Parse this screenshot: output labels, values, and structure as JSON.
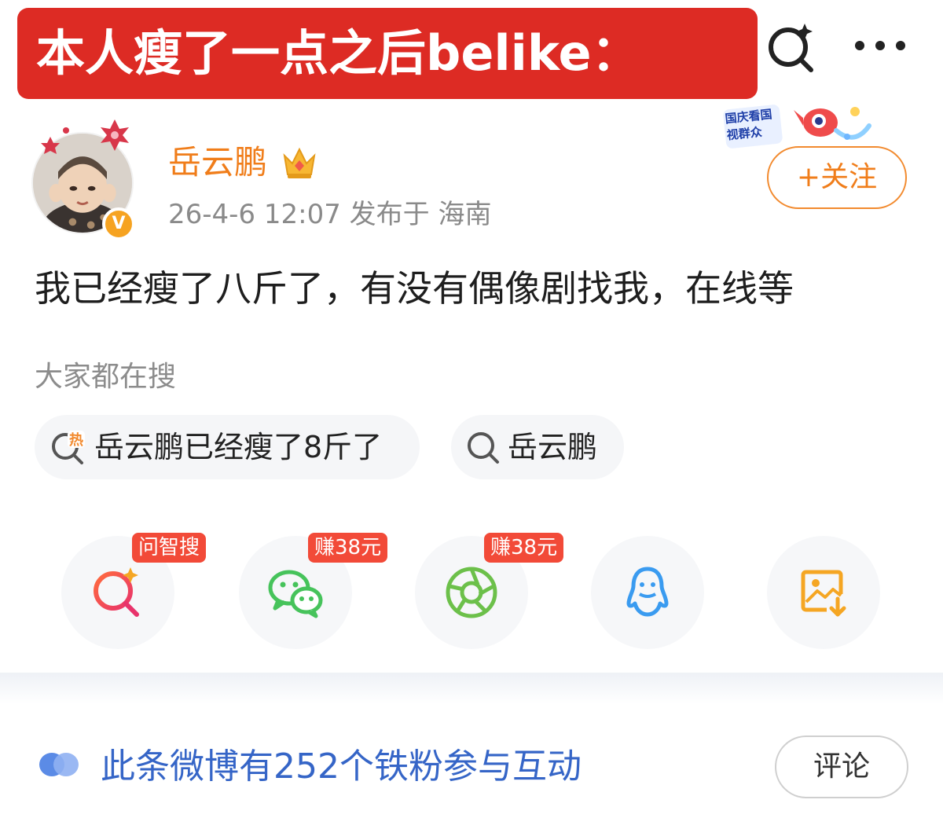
{
  "banner": {
    "title": "本人瘦了一点之后belike："
  },
  "event_badge": {
    "text": "国庆看国视群众"
  },
  "author": {
    "name": "岳云鹏",
    "verified_mark": "V",
    "meta": "26-4-6 12:07  发布于 海南",
    "follow_label": "+关注"
  },
  "post": {
    "text": "我已经瘦了八斤了，有没有偶像剧找我，在线等"
  },
  "search_section": {
    "label": "大家都在搜",
    "chips": [
      {
        "text": "岳云鹏已经瘦了8斤了",
        "icon": "hot-search-icon",
        "icon_text": "热"
      },
      {
        "text": "岳云鹏",
        "icon": "search-icon"
      }
    ]
  },
  "share_actions": [
    {
      "icon": "ai-search-icon",
      "badge": "问智搜"
    },
    {
      "icon": "wechat-icon",
      "badge": "赚38元"
    },
    {
      "icon": "moments-icon",
      "badge": "赚38元"
    },
    {
      "icon": "qq-icon",
      "badge": ""
    },
    {
      "icon": "save-image-icon",
      "badge": ""
    }
  ],
  "footer": {
    "fans_text": "此条微博有252个铁粉参与互动",
    "comment_label": "评论"
  },
  "colors": {
    "banner": "#dd2b24",
    "accent_orange": "#f07d1a",
    "badge_red": "#f24a38",
    "link_blue": "#3565c7",
    "wechat_green": "#46c35b",
    "qq_blue": "#3a9bf0",
    "save_orange": "#f5a623"
  }
}
